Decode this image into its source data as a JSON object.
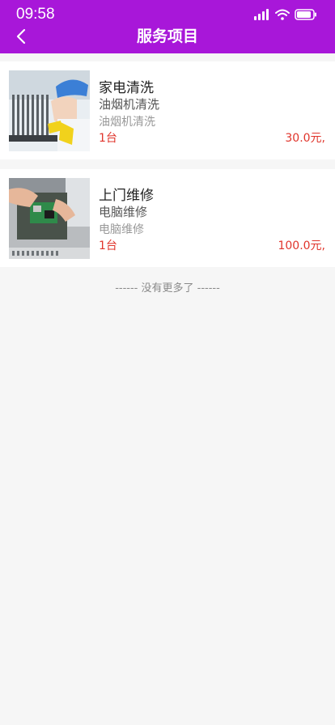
{
  "status_bar": {
    "time": "09:58"
  },
  "header": {
    "title": "服务项目"
  },
  "items": [
    {
      "title": "家电清洗",
      "subtitle": "油烟机清洗",
      "description": "油烟机清洗",
      "quantity": "1台",
      "price": "30.0元,"
    },
    {
      "title": "上门维修",
      "subtitle": "电脑维修",
      "description": "电脑维修",
      "quantity": "1台",
      "price": "100.0元,"
    }
  ],
  "footer": {
    "no_more": "------ 没有更多了 ------"
  },
  "colors": {
    "header_bg": "#a817d9",
    "price": "#e0342b",
    "page_bg": "#f6f6f6"
  }
}
